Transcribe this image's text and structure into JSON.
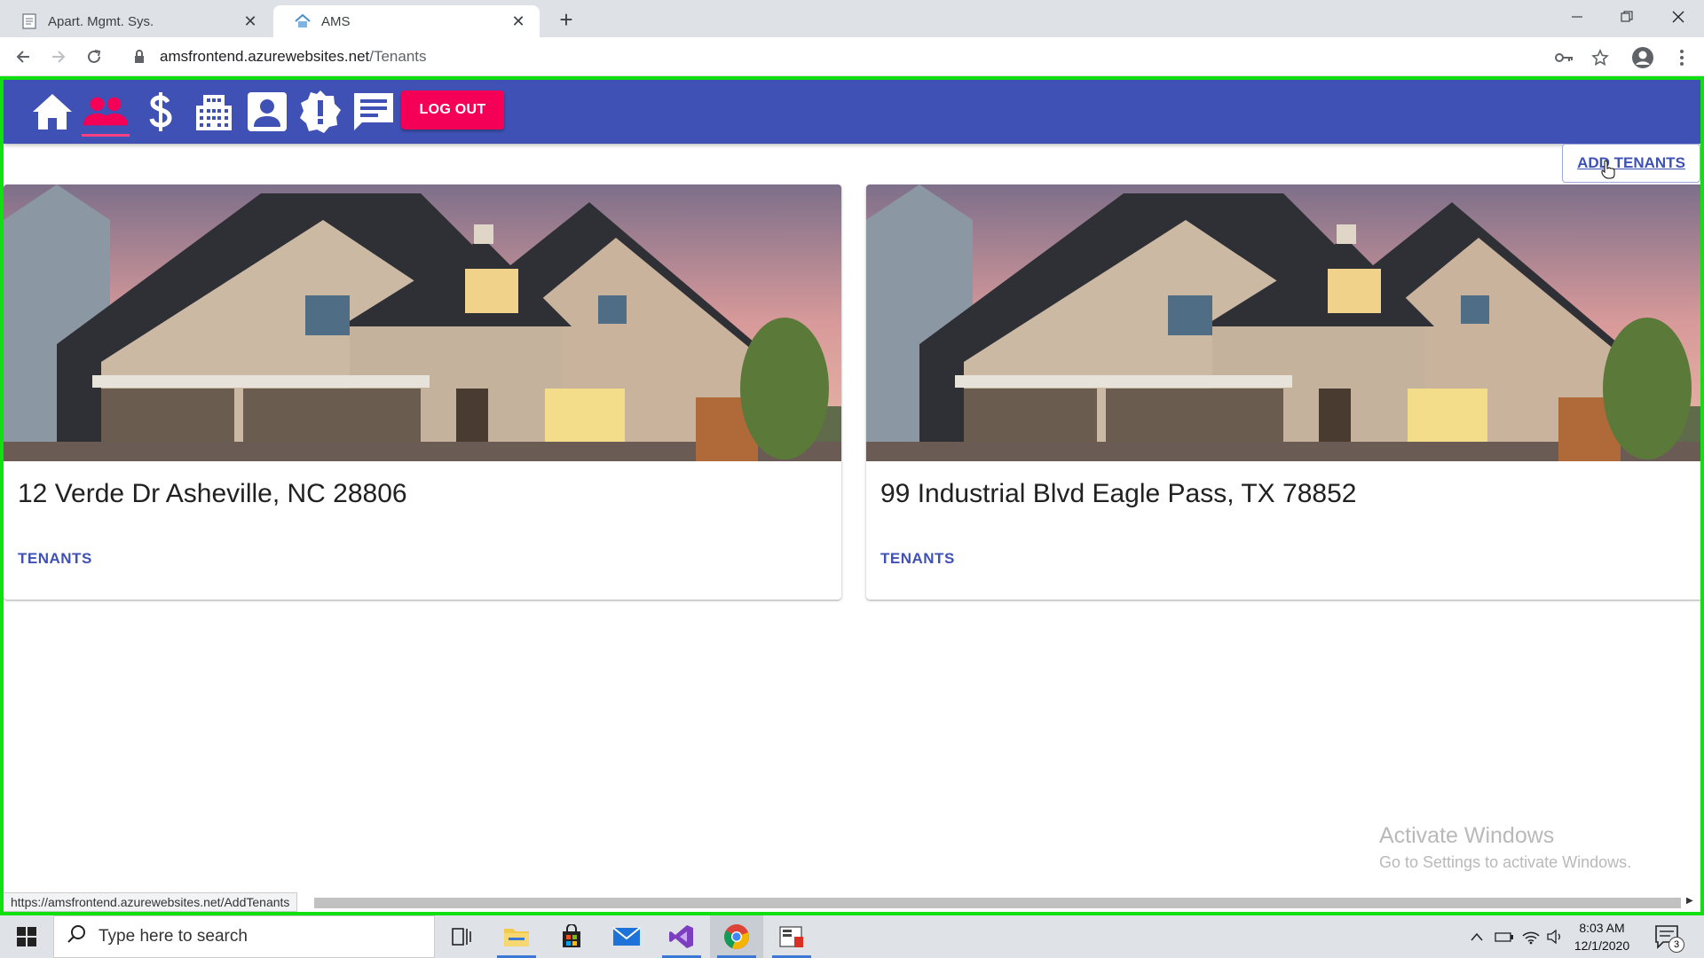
{
  "browser": {
    "tabs": [
      {
        "title": "Apart. Mgmt. Sys.",
        "favicon": "document-icon"
      },
      {
        "title": "AMS",
        "favicon": "house-icon",
        "active": true
      }
    ],
    "url_host": "amsfrontend.azurewebsites.net",
    "url_path": "/Tenants",
    "status_url": "https://amsfrontend.azurewebsites.net/AddTenants"
  },
  "app": {
    "nav_icons": [
      "home-icon",
      "people-icon",
      "dollar-icon",
      "building-icon",
      "person-badge-icon",
      "alert-icon",
      "message-icon"
    ],
    "logout_label": "LOG OUT",
    "add_tenants_label": "ADD TENANTS",
    "primary_color": "#3f51b5",
    "accent_color": "#f50057"
  },
  "properties": [
    {
      "address": "12 Verde Dr Asheville, NC 28806",
      "link_label": "TENANTS"
    },
    {
      "address": "99 Industrial Blvd Eagle Pass, TX 78852",
      "link_label": "TENANTS"
    }
  ],
  "watermark": {
    "title": "Activate Windows",
    "subtitle": "Go to Settings to activate Windows."
  },
  "taskbar": {
    "search_placeholder": "Type here to search",
    "time": "8:03 AM",
    "date": "12/1/2020",
    "notification_count": "3"
  }
}
